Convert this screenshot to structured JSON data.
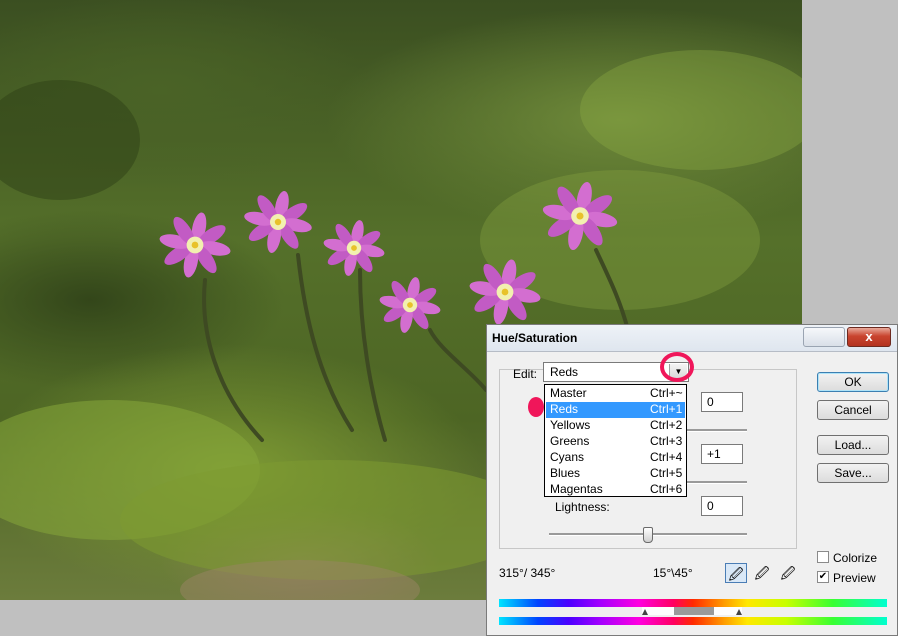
{
  "dialog": {
    "title": "Hue/Saturation",
    "close_glyph": "x",
    "edit_label": "Edit:",
    "edit_value": "Reds",
    "dropdown_items": [
      {
        "label": "Master",
        "shortcut": "Ctrl+~"
      },
      {
        "label": "Reds",
        "shortcut": "Ctrl+1"
      },
      {
        "label": "Yellows",
        "shortcut": "Ctrl+2"
      },
      {
        "label": "Greens",
        "shortcut": "Ctrl+3"
      },
      {
        "label": "Cyans",
        "shortcut": "Ctrl+4"
      },
      {
        "label": "Blues",
        "shortcut": "Ctrl+5"
      },
      {
        "label": "Magentas",
        "shortcut": "Ctrl+6"
      }
    ],
    "selected_item": "Reds",
    "hue_value": "0",
    "saturation_value": "+1",
    "lightness_label": "Lightness:",
    "lightness_value": "0",
    "buttons": {
      "ok": "OK",
      "cancel": "Cancel",
      "load": "Load...",
      "save": "Save..."
    },
    "colorize_label": "Colorize",
    "colorize_checked": false,
    "preview_label": "Preview",
    "preview_checked": true,
    "range_left": "315°/ 345°",
    "range_right": "15°\\45°"
  },
  "colors": {
    "annotation": "#f0165a",
    "selection": "#3399ff"
  },
  "icons": [
    "eyedropper-icon",
    "eyedropper-plus-icon",
    "eyedropper-minus-icon",
    "dropdown-arrow-icon",
    "close-icon"
  ]
}
